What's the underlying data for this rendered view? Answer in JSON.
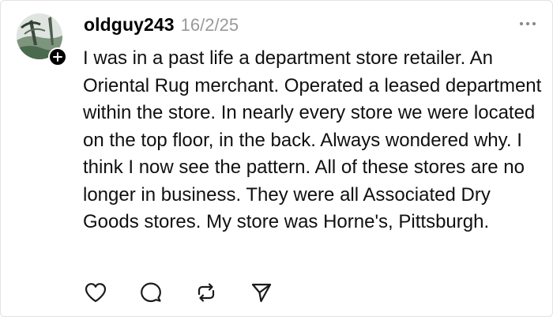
{
  "post": {
    "username": "oldguy243",
    "date": "16/2/25",
    "body": "I was in a past life a department store retailer. An Oriental Rug merchant. Operated a leased department within the store. In nearly every store we were located on the top floor, in the back. Always wondered why. I think I now see the pattern. All of these stores are no longer in business. They were all Associated Dry Goods stores. My store was Horne's, Pittsburgh."
  },
  "icons": {
    "more": "more-horizontal-icon",
    "follow": "plus-icon",
    "like": "heart-icon",
    "reply": "comment-icon",
    "repost": "repost-icon",
    "share": "send-icon"
  },
  "colors": {
    "text": "#101010",
    "muted": "#999999",
    "icon": "#1a1a1a",
    "border": "#e2e2e2"
  }
}
